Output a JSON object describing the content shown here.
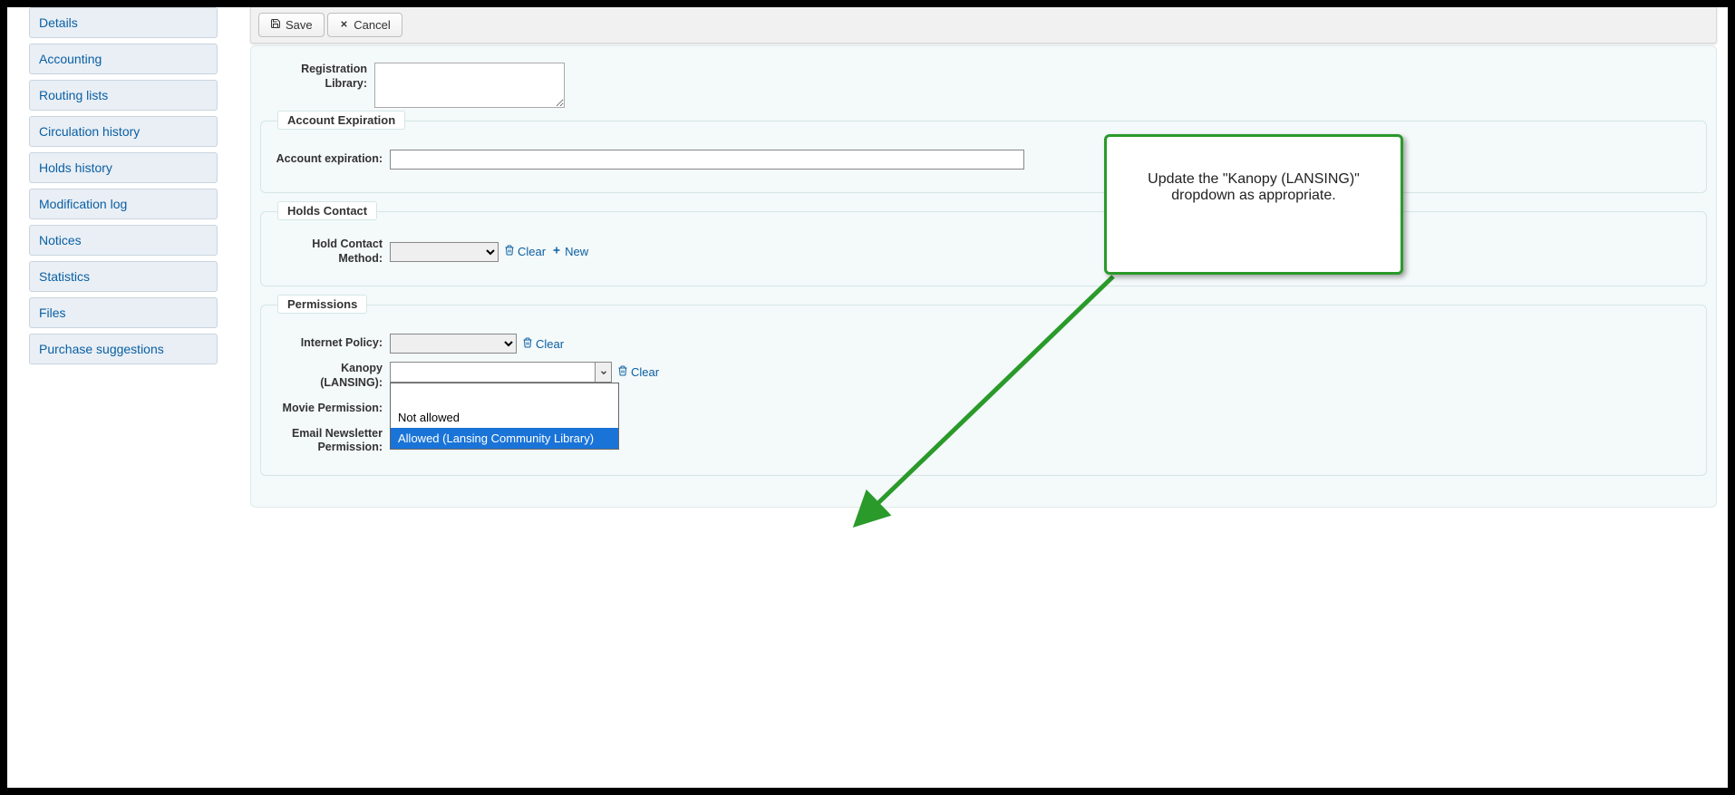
{
  "sidebar": {
    "items": [
      {
        "label": "Details"
      },
      {
        "label": "Accounting"
      },
      {
        "label": "Routing lists"
      },
      {
        "label": "Circulation history"
      },
      {
        "label": "Holds history"
      },
      {
        "label": "Modification log"
      },
      {
        "label": "Notices"
      },
      {
        "label": "Statistics"
      },
      {
        "label": "Files"
      },
      {
        "label": "Purchase suggestions"
      }
    ]
  },
  "toolbar": {
    "save_label": "Save",
    "cancel_label": "Cancel"
  },
  "form": {
    "registration_library_label": "Registration Library:",
    "registration_library_value": "",
    "account_expiration_legend": "Account Expiration",
    "account_expiration_label": "Account expiration:",
    "account_expiration_value": "",
    "holds_contact_legend": "Holds Contact",
    "holds_contact_label": "Hold Contact Method:",
    "permissions_legend": "Permissions",
    "internet_policy_label": "Internet Policy:",
    "kanopy_label": "Kanopy (LANSING):",
    "kanopy_options": {
      "not_allowed": "Not allowed",
      "allowed": "Allowed (Lansing Community Library)"
    },
    "movie_permission_label": "Movie Permission:",
    "email_newsletter_label": "Email Newsletter Permission:"
  },
  "actions": {
    "clear": "Clear",
    "new": "New"
  },
  "callout": {
    "line1": "Update the \"Kanopy (LANSING)\"",
    "line2": "dropdown as appropriate."
  }
}
